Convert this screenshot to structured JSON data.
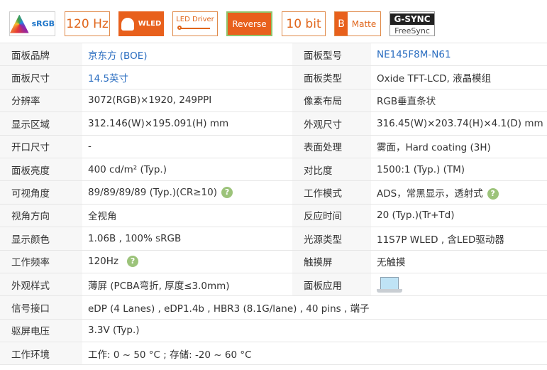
{
  "badges": {
    "srgb": "sRGB",
    "refresh": "120 Hz",
    "wled": "WLED",
    "led_driver": "LED Driver",
    "reverse": "Reverse",
    "bit": "10 bit",
    "matte_letter": "B",
    "matte": "Matte",
    "gsync": "G-SYNC",
    "freesync": "FreeSync"
  },
  "specs": {
    "brand_label": "面板品牌",
    "brand_value": "京东方 (BOE)",
    "model_label": "面板型号",
    "model_value": "NE145F8M-N61",
    "size_label": "面板尺寸",
    "size_value": "14.5英寸",
    "type_label": "面板类型",
    "type_value": "Oxide TFT-LCD, 液晶模组",
    "res_label": "分辨率",
    "res_value": "3072(RGB)×1920, 249PPI",
    "pixel_label": "像素布局",
    "pixel_value": "RGB垂直条状",
    "area_label": "显示区域",
    "area_value": "312.146(W)×195.091(H) mm",
    "outline_label": "外观尺寸",
    "outline_value": "316.45(W)×203.74(H)×4.1(D) mm",
    "opening_label": "开口尺寸",
    "opening_value": "-",
    "surface_label": "表面处理",
    "surface_value": "雾面，Hard coating (3H)",
    "brightness_label": "面板亮度",
    "brightness_value": "400 cd/m² (Typ.)",
    "contrast_label": "对比度",
    "contrast_value": "1500:1 (Typ.) (TM)",
    "viewing_label": "可视角度",
    "viewing_value": "89/89/89/89 (Typ.)(CR≥10)",
    "mode_label": "工作模式",
    "mode_value": "ADS，常黑显示，透射式",
    "direction_label": "视角方向",
    "direction_value": "全视角",
    "response_label": "反应时间",
    "response_value": "20 (Typ.)(Tr+Td)",
    "colors_label": "显示颜色",
    "colors_value": "1.06B , 100% sRGB",
    "light_label": "光源类型",
    "light_value": "11S7P WLED , 含LED驱动器",
    "freq_label": "工作频率",
    "freq_value": "120Hz",
    "touch_label": "触摸屏",
    "touch_value": "无触摸",
    "style_label": "外观样式",
    "style_value": "薄屏 (PCBA弯折, 厚度≤3.0mm)",
    "app_label": "面板应用",
    "interface_label": "信号接口",
    "interface_value": "eDP (4 Lanes) , eDP1.4b , HBR3 (8.1G/lane) , 40 pins , 端子",
    "voltage_label": "驱屏电压",
    "voltage_value": "3.3V (Typ.)",
    "env_label": "工作环境",
    "env_value": "工作: 0 ~ 50 °C ; 存储: -20 ~ 60 °C"
  },
  "icons": {
    "help": "question-help-icon",
    "app": "laptop-icon",
    "help_glyph": "?"
  },
  "colors": {
    "accent_orange": "#e8601c",
    "link_blue": "#2a6dc0",
    "help_green": "#9cc37a"
  }
}
